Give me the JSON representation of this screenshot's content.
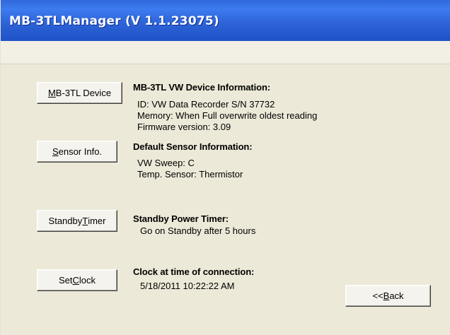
{
  "window": {
    "title": "MB-3TLManager (V 1.1.23075)"
  },
  "buttons": {
    "device": {
      "pre": "",
      "accel": "M",
      "post": "B-3TL Device"
    },
    "sensor": {
      "pre": "",
      "accel": "S",
      "post": "ensor Info."
    },
    "standby": {
      "pre": "Standby ",
      "accel": "T",
      "post": "imer"
    },
    "clock": {
      "pre": "Set ",
      "accel": "C",
      "post": "lock"
    },
    "back": {
      "pre": "<< ",
      "accel": "B",
      "post": "ack"
    }
  },
  "device_info": {
    "heading": "MB-3TL VW Device Information:",
    "id_line": "ID:  VW Data Recorder S/N 37732",
    "memory_line": "Memory:  When Full overwrite oldest reading",
    "firmware_line": "Firmware version: 3.09"
  },
  "sensor_info": {
    "heading": "Default Sensor Information:",
    "sweep_line": "VW Sweep:  C",
    "temp_line": "Temp. Sensor: Thermistor"
  },
  "standby_info": {
    "heading": "Standby Power Timer:",
    "line": "Go on Standby after 5 hours"
  },
  "clock_info": {
    "heading": "Clock at time of connection:",
    "line": "5/18/2011 10:22:22 AM"
  },
  "colors": {
    "titlebar": "#2e64d8",
    "face": "#ece9d8",
    "title_text": "#ffffff"
  }
}
